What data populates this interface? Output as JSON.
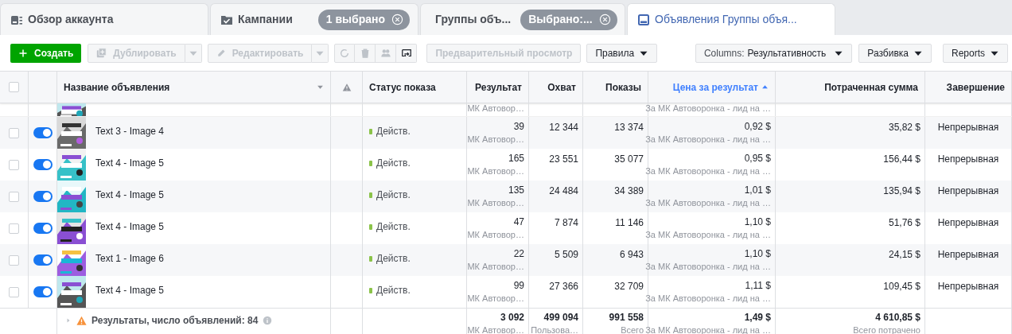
{
  "tabs": [
    {
      "kind": "overview",
      "label": "Обзор аккаунта",
      "selected": false
    },
    {
      "kind": "campaigns",
      "label": "Кампании",
      "selected": false,
      "badge": "1 выбрано"
    },
    {
      "kind": "groups",
      "label": "Группы объ...",
      "selected": false,
      "badge": "Выбрано:..."
    },
    {
      "kind": "ads",
      "label": "Объявления Группы объя...",
      "selected": true
    }
  ],
  "toolbar": {
    "buttons": [
      {
        "kind": "create",
        "label": "Создать",
        "disabled": false
      },
      {
        "kind": "duplicate",
        "label": "Дублировать",
        "disabled": true
      },
      {
        "kind": "edit",
        "label": "Редактировать",
        "disabled": true
      }
    ],
    "icon_buttons": [
      {
        "kind": "refresh",
        "disabled": true
      },
      {
        "kind": "delete",
        "disabled": true
      },
      {
        "kind": "people",
        "disabled": true
      },
      {
        "kind": "export",
        "disabled": false
      }
    ],
    "preview": {
      "label": "Предварительный просмотр",
      "disabled": true
    },
    "rules": {
      "label": "Правила"
    },
    "columns": {
      "label": "Columns:",
      "value": "Результативность"
    },
    "breakdown": {
      "label": "Разбивка"
    },
    "reports": {
      "label": "Reports"
    }
  },
  "table": {
    "columns": [
      {
        "kind": "check",
        "selected": false
      },
      {
        "kind": "text",
        "label": "Название объявления",
        "sorted": false
      },
      {
        "kind": "warning",
        "sorted": false
      },
      {
        "kind": "text",
        "label": "Статус показа",
        "sorted": false
      },
      {
        "kind": "number",
        "label": "Результат",
        "sorted": false
      },
      {
        "kind": "number",
        "label": "Охват",
        "sorted": false
      },
      {
        "kind": "number",
        "label": "Показы",
        "sorted": false
      },
      {
        "kind": "number",
        "label": "Цена за результат",
        "sorted": true
      },
      {
        "kind": "number",
        "label": "Потраченная сумма",
        "sorted": false
      },
      {
        "kind": "number",
        "label": "Завершение",
        "sorted": false
      }
    ],
    "partial_row": {
      "result_note": "МК Автовор…",
      "cost_note": "За МК Автоворонка - лид на …"
    },
    "rows": [
      {
        "selected": false,
        "on": true,
        "name": "Text 3 - Image 4",
        "status": "Действ.",
        "color": "#8bc34a",
        "results": "39",
        "results_note": "МК Автовор…",
        "reach": "12 344",
        "impressions": "13 374",
        "cost": "0,92 $",
        "cost_note": "За МК Автоворонка - лид на …",
        "spent": "35,82 $",
        "end": "Непрерывная"
      },
      {
        "selected": false,
        "on": true,
        "name": "Text 4 - Image 5",
        "status": "Действ.",
        "color": "#8bc34a",
        "results": "165",
        "results_note": "МК Автовор…",
        "reach": "23 551",
        "impressions": "35 077",
        "cost": "0,95 $",
        "cost_note": "За МК Автоворонка - лид на …",
        "spent": "156,44 $",
        "end": "Непрерывная"
      },
      {
        "selected": false,
        "on": true,
        "name": "Text 4 - Image 5",
        "status": "Действ.",
        "color": "#8bc34a",
        "results": "135",
        "results_note": "МК Автовор…",
        "reach": "24 484",
        "impressions": "34 389",
        "cost": "1,01 $",
        "cost_note": "За МК Автоворонка - лид на …",
        "spent": "135,94 $",
        "end": "Непрерывная"
      },
      {
        "selected": false,
        "on": true,
        "name": "Text 4 - Image 5",
        "status": "Действ.",
        "color": "#8bc34a",
        "results": "47",
        "results_note": "МК Автовор…",
        "reach": "7 874",
        "impressions": "11 146",
        "cost": "1,10 $",
        "cost_note": "За МК Автоворонка - лид на …",
        "spent": "51,76 $",
        "end": "Непрерывная"
      },
      {
        "selected": false,
        "on": true,
        "name": "Text 1 - Image 6",
        "status": "Действ.",
        "color": "#8bc34a",
        "results": "22",
        "results_note": "МК Автовор…",
        "reach": "5 509",
        "impressions": "6 943",
        "cost": "1,10 $",
        "cost_note": "За МК Автоворонка - лид на …",
        "spent": "24,15 $",
        "end": "Непрерывная"
      },
      {
        "selected": false,
        "on": true,
        "name": "Text 4 - Image 5",
        "status": "Действ.",
        "color": "#8bc34a",
        "results": "99",
        "results_note": "МК Автовор…",
        "reach": "27 366",
        "impressions": "32 709",
        "cost": "1,11 $",
        "cost_note": "За МК Автоворонка - лид на …",
        "spent": "109,45 $",
        "end": "Непрерывная"
      }
    ],
    "summary": {
      "label": "Результаты, число объявлений: 84",
      "results": "3 092",
      "results_note": "МК Автовор…",
      "reach": "499 094",
      "reach_note": "Пользова…",
      "impressions": "991 558",
      "impressions_note": "Всего",
      "cost": "1,49 $",
      "cost_note": "За МК Автоворонка - лид на …",
      "spent": "4 610,85 $",
      "spent_note": "Всего потрачено"
    }
  }
}
